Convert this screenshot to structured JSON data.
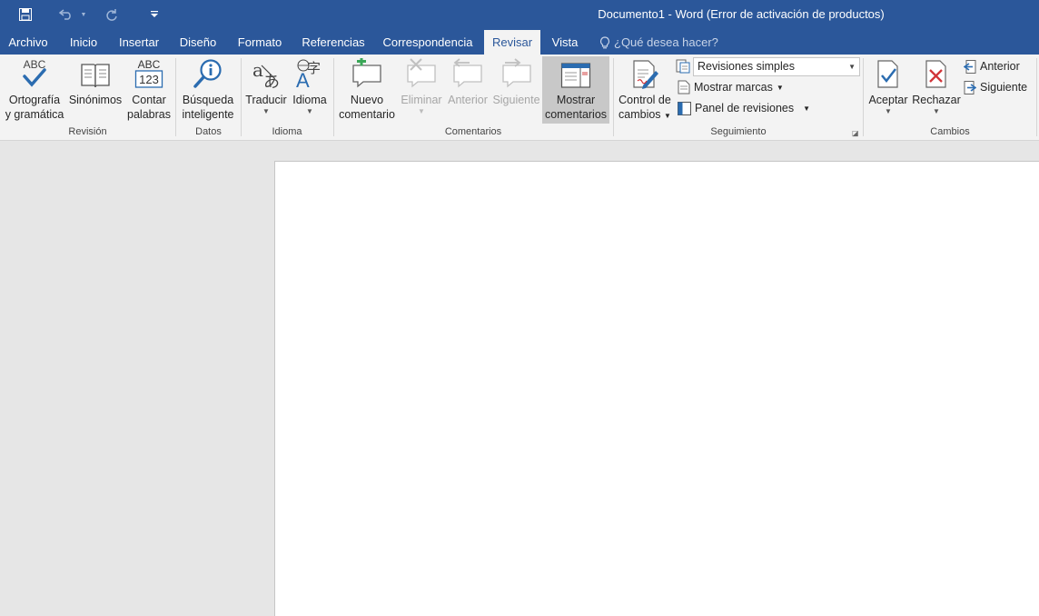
{
  "window": {
    "title": "Documento1 - Word (Error de activación de productos)"
  },
  "qat": {
    "icons": [
      "save-icon",
      "undo-icon",
      "redo-icon",
      "customize-qat-icon"
    ]
  },
  "tabs": [
    {
      "label": "Archivo"
    },
    {
      "label": "Inicio"
    },
    {
      "label": "Insertar"
    },
    {
      "label": "Diseño"
    },
    {
      "label": "Formato"
    },
    {
      "label": "Referencias"
    },
    {
      "label": "Correspondencia"
    },
    {
      "label": "Revisar",
      "active": true
    },
    {
      "label": "Vista"
    }
  ],
  "tellme": {
    "placeholder": "¿Qué desea hacer?"
  },
  "ribbon": {
    "revision": {
      "label": "Revisión",
      "spelling": {
        "line1": "Ortografía",
        "line2": "y gramática",
        "icon_text": "ABC"
      },
      "thesaurus": {
        "line1": "Sinónimos"
      },
      "wordcount": {
        "line1": "Contar",
        "line2": "palabras",
        "icon_top": "ABC",
        "icon_bottom": "123"
      }
    },
    "datos": {
      "label": "Datos",
      "smart": {
        "line1": "Búsqueda",
        "line2": "inteligente"
      }
    },
    "idioma": {
      "label": "Idioma",
      "translate": {
        "line1": "Traducir"
      },
      "language": {
        "line1": "Idioma"
      }
    },
    "comentarios": {
      "label": "Comentarios",
      "new": {
        "line1": "Nuevo",
        "line2": "comentario"
      },
      "delete": {
        "line1": "Eliminar"
      },
      "previous": {
        "line1": "Anterior"
      },
      "next": {
        "line1": "Siguiente"
      },
      "show": {
        "line1": "Mostrar",
        "line2": "comentarios"
      }
    },
    "seguimiento": {
      "label": "Seguimiento",
      "track": {
        "line1": "Control de",
        "line2": "cambios"
      },
      "display_select": "Revisiones simples",
      "show_markup": "Mostrar marcas",
      "reviewing_pane": "Panel de revisiones"
    },
    "cambios": {
      "label": "Cambios",
      "accept": {
        "line1": "Aceptar"
      },
      "reject": {
        "line1": "Rechazar"
      },
      "previous": "Anterior",
      "next": "Siguiente"
    }
  },
  "colors": {
    "brand": "#2b579a",
    "ribbon_bg": "#f3f3f3",
    "doc_bg": "#e6e6e6",
    "check_blue": "#2b6cb0",
    "reject_red": "#d13438",
    "add_green": "#3aa757"
  }
}
